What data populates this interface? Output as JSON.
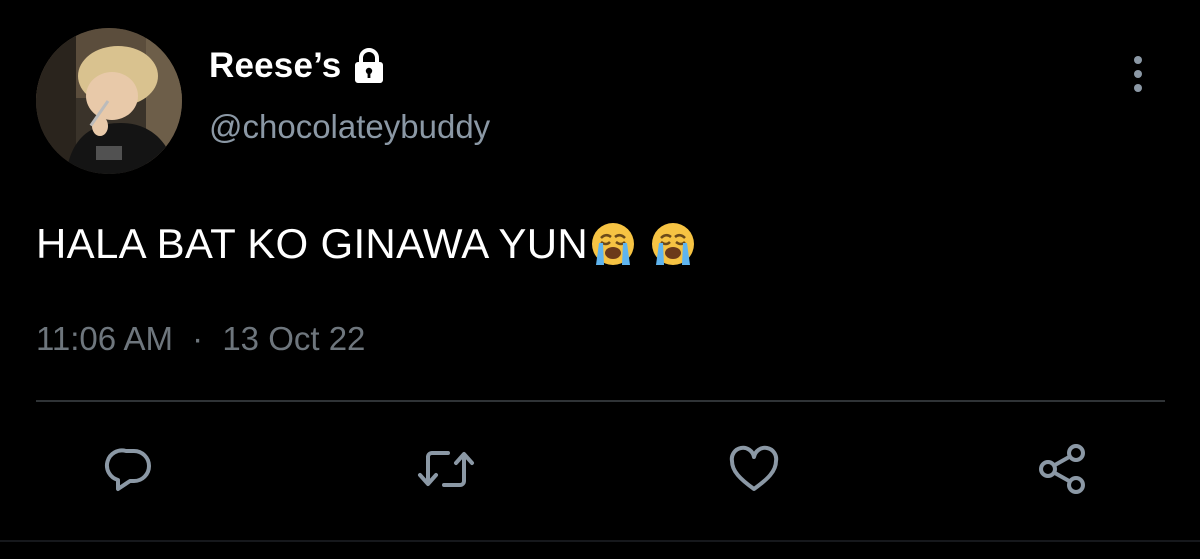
{
  "tweet": {
    "author": {
      "display_name": "Reese’s",
      "handle": "@chocolateybuddy",
      "protected_icon": "lock-icon",
      "avatar_alt": "profile photo"
    },
    "text": "HALA BAT KO GINAWA YUN",
    "emojis": [
      "loudly-crying-face",
      "loudly-crying-face"
    ],
    "time": "11:06 AM",
    "separator": "·",
    "date": "13 Oct 22"
  },
  "actions": [
    {
      "name": "reply",
      "icon": "reply-icon"
    },
    {
      "name": "retweet",
      "icon": "retweet-icon"
    },
    {
      "name": "like",
      "icon": "heart-icon"
    },
    {
      "name": "share",
      "icon": "share-icon"
    }
  ],
  "colors": {
    "background": "#000000",
    "text_primary": "#ffffff",
    "text_secondary": "#8b98a5",
    "timestamp": "#6e767d",
    "icon": "#8b98a5",
    "divider": "#2f3336"
  }
}
